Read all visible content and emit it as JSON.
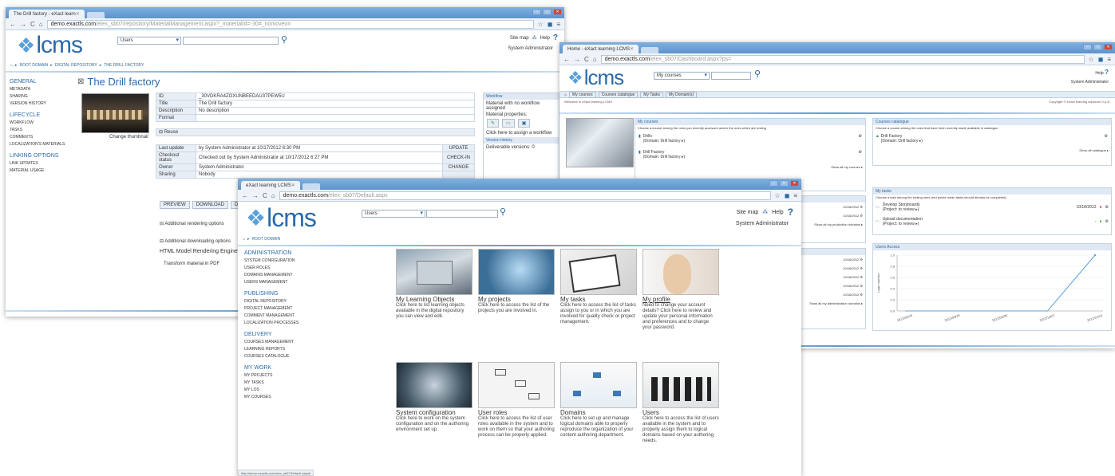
{
  "w1": {
    "tab_title": "The Drill factory - eXact learn",
    "url_host": "demo.exactls.com",
    "url_path": "/elex_sb07/repository/MaterialManagement.aspx?_materialId=-30#_nomoveon",
    "search_scope": "Users",
    "site_map": "Site map",
    "help": "Help",
    "user": "System Administrator",
    "breadcrumb": [
      "ROOT DOMAIN",
      "DIGITAL REPOSITORY",
      "THE DRILL FACTORY"
    ],
    "nav": [
      {
        "head": "GENERAL",
        "items": [
          "METADATA",
          "SHARING",
          "VERSION HISTORY"
        ]
      },
      {
        "head": "LIFECYCLE",
        "items": [
          "WORKFLOW",
          "TASKS",
          "COMMENTS",
          "LOCALIZATION'S MATERIALS"
        ]
      },
      {
        "head": "LINKING OPTIONS",
        "items": [
          "LINK UPDATES",
          "MATERIAL USAGE"
        ]
      }
    ],
    "title": "The Drill factory",
    "change_thumbnail": "Change thumbnail",
    "props": [
      {
        "k": "ID",
        "v": "_30VDKRA4ZOXUNBEEDAU37PEW5U"
      },
      {
        "k": "Title",
        "v": "The Drill factory"
      },
      {
        "k": "Description",
        "v": "No description"
      },
      {
        "k": "Format",
        "v": ""
      }
    ],
    "reuse": "Reuse",
    "last_update_label": "Last update",
    "last_update": "by System Administrator at 10/17/2012 6:30 PM",
    "update_btn": "UPDATE",
    "checkout_label": "Checkout status",
    "checkout": "Checked out by System Administrator at 10/17/2012 6:27 PM",
    "checkin_btn": "CHECK-IN",
    "owner_label": "Owner",
    "owner": "System Administrator",
    "change_btn": "CHANGE",
    "sharing_label": "Sharing",
    "sharing": "Nobody",
    "actions": [
      "PREVIEW",
      "DOWNLOAD",
      "DELETE"
    ],
    "add_render": "Additional rendering options",
    "add_download": "Additional downloading options",
    "html_engine": "HTML Model Rendering Engine",
    "transform_pdf": "Transform material in PDF",
    "workflow_head": "Workflow",
    "workflow_text": "Material with no workflow assigned",
    "material_props": "Material properties:",
    "assign_wf": "Click here to assign a workflow",
    "version_head": "Version history",
    "version_text": "Deliverable versions: 0"
  },
  "w2": {
    "tab_title": "Home - eXact learning LCMS",
    "url_host": "demo.exactls.com",
    "url_path": "/elex_sb07/Dashboard.aspx?ps=",
    "search_scope": "My courses",
    "help": "Help",
    "user": "System Administrator",
    "tabs": [
      "My courses",
      "Courses catalogue",
      "My Tasks",
      "My Domain(s)"
    ],
    "welcome": "Welcome to eXact learning LCMS",
    "copyright": "Copyright © eXact learning solutions S.p.A.",
    "my_courses": {
      "head": "My courses",
      "sub": "Choose a course among the ones you recently accessed and/or the ones which are ending",
      "items": [
        {
          "name": "Drills",
          "domain": "(Domain: Drill factory ▸)"
        },
        {
          "name": "Drill Factory",
          "domain": "(Domain: Drill factory ▸)"
        }
      ],
      "more": "Show all my courses ▸"
    },
    "catalogue": {
      "head": "Courses catalogue",
      "sub": "Choose a course among the ones that have been recently made available in catalogue",
      "items": [
        {
          "name": "Drill Factory",
          "domain": "(Domain: Drill factory ▸)"
        }
      ],
      "more": "Show all catalogue ▸"
    },
    "prod_dates": [
      "10/16/2012",
      "10/16/2012"
    ],
    "prod_more": "Show all my production domains ▸",
    "admin_dates": [
      "10/16/2012",
      "10/16/2012",
      "10/16/2012",
      "10/16/2012",
      "10/16/2012"
    ],
    "admin_more": "Show all my administration domains ▸",
    "tasks": {
      "head": "My tasks",
      "sub": "Choose a task among the ending ones (red points mean tasks should already be completed)",
      "items": [
        {
          "name": "Develop Storyboards",
          "project": "(Project: to review ▸)",
          "date": "10/18/2012",
          "dot": "#d22"
        },
        {
          "name": "Upload documentation",
          "project": "(Project: to review ▸)",
          "date": "-",
          "dot": "#2a2"
        }
      ]
    },
    "chart": {
      "head": "Users Access",
      "ylabel": "Login number",
      "yticks": [
        "1.0",
        "0.8",
        "0.6",
        "0.4",
        "0.2",
        "0.0"
      ],
      "xticks": [
        "2012/09/16",
        "2012/09/23",
        "2012/09/30",
        "2012/10/07",
        "2012/10/14"
      ]
    },
    "chart_data": {
      "type": "line",
      "title": "Users Access",
      "ylabel": "Login number",
      "ylim": [
        0,
        1
      ],
      "x": [
        "2012/09/16",
        "2012/09/23",
        "2012/09/30",
        "2012/10/07",
        "2012/10/14"
      ],
      "series": [
        {
          "values": [
            0,
            0,
            0,
            0,
            1
          ]
        }
      ]
    }
  },
  "w3": {
    "tab_title": "eXact learning LCMS",
    "url_host": "demo.exactls.com",
    "url_path": "/elex_sb07/Default.aspx",
    "search_scope": "Users",
    "site_map": "Site map",
    "help": "Help",
    "user": "System Administrator",
    "breadcrumb": "ROOT DOMAIN",
    "nav": [
      {
        "head": "ADMINISTRATION",
        "items": [
          "SYSTEM CONFIGURATION",
          "USER ROLES",
          "DOMAINS MANAGEMENT",
          "USERS MANAGEMENT"
        ]
      },
      {
        "head": "PUBLISHING",
        "items": [
          "DIGITAL REPOSITORY",
          "PROJECT MANAGEMENT",
          "COMMENT MANAGEMENT",
          "LOCALIZATION PROCESSES"
        ]
      },
      {
        "head": "DELIVERY",
        "items": [
          "COURSES MANAGEMENT",
          "LEARNING REPORTS",
          "COURSES CATALOGUE"
        ]
      },
      {
        "head": "MY WORK",
        "items": [
          "MY PROJECTS",
          "MY TASKS",
          "MY LOS",
          "MY COURSES"
        ]
      }
    ],
    "tiles": [
      {
        "title": "My Learning Objects",
        "desc": "Click here to list learning objects available in the digital repository you can view and edit."
      },
      {
        "title": "My projects",
        "desc": "Click here to access the list of the projects you are involved in."
      },
      {
        "title": "My tasks",
        "desc": "Click here to access the list of tasks assign to you or in which you are involved for quality check or project management."
      },
      {
        "title": "My profile",
        "desc": "Need to change your account details? Click here to review and update your personal information and preferences and to change your password."
      },
      {
        "title": "System configuration",
        "desc": "Click here to work on the system configuration and on the authoring environment set up."
      },
      {
        "title": "User roles",
        "desc": "Click here to access the list of user roles available in the system and to work on them so that your authoring process can be properly applied."
      },
      {
        "title": "Domains",
        "desc": "Click here to set up and manage logical domains able to properly reproduce the organization of your content authoring department."
      },
      {
        "title": "Users",
        "desc": "Click here to access the list of users available in the system and to properly assign them to logical domains based on your authoring needs."
      }
    ],
    "status": "http://demo.exactls.com/elex_sb07/Default.aspx#"
  }
}
